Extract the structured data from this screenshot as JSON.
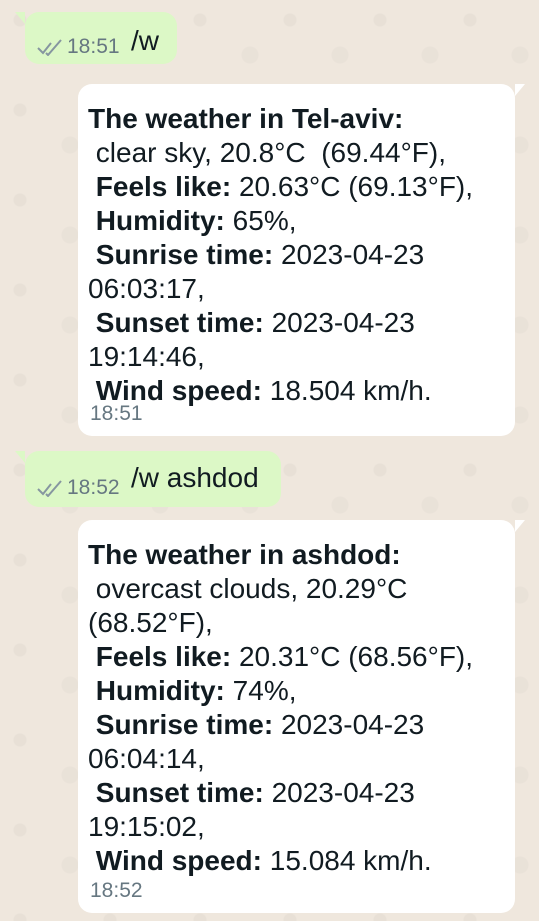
{
  "messages": [
    {
      "type": "outgoing",
      "time": "18:51",
      "text": "/w"
    },
    {
      "type": "incoming",
      "time": "18:51",
      "lines": [
        {
          "label": "The weather in Tel-aviv:",
          "value": ""
        },
        {
          "label": "",
          "value": " clear sky, 20.8°C  (69.44°F),"
        },
        {
          "label": " Feels like:",
          "value": " 20.63°C (69.13°F),"
        },
        {
          "label": " Humidity:",
          "value": " 65%,"
        },
        {
          "label": " Sunrise time:",
          "value": " 2023-04-23"
        },
        {
          "label": "",
          "value": "06:03:17,"
        },
        {
          "label": " Sunset time:",
          "value": " 2023-04-23"
        },
        {
          "label": "",
          "value": "19:14:46,"
        },
        {
          "label": " Wind speed:",
          "value": " 18.504 km/h."
        }
      ]
    },
    {
      "type": "outgoing",
      "time": "18:52",
      "text": "/w ashdod"
    },
    {
      "type": "incoming",
      "time": "18:52",
      "lines": [
        {
          "label": "The weather in ashdod:",
          "value": ""
        },
        {
          "label": "",
          "value": " overcast clouds, 20.29°C"
        },
        {
          "label": "",
          "value": "(68.52°F),"
        },
        {
          "label": " Feels like:",
          "value": " 20.31°C (68.56°F),"
        },
        {
          "label": " Humidity:",
          "value": " 74%,"
        },
        {
          "label": " Sunrise time:",
          "value": " 2023-04-23"
        },
        {
          "label": "",
          "value": "06:04:14,"
        },
        {
          "label": " Sunset time:",
          "value": " 2023-04-23"
        },
        {
          "label": "",
          "value": "19:15:02,"
        },
        {
          "label": " Wind speed:",
          "value": " 15.084 km/h."
        }
      ]
    }
  ]
}
